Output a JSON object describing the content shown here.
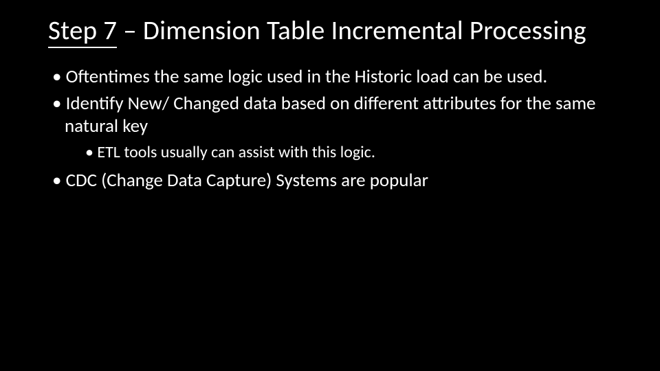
{
  "title": {
    "step_label": "Step 7",
    "rest": " – Dimension Table Incremental Processing"
  },
  "bullets": [
    {
      "text": "Oftentimes the same logic used in the Historic load can be used.",
      "children": []
    },
    {
      "text": "Identify New/ Changed data based on different attributes for the same natural key",
      "children": [
        {
          "text": "ETL tools usually can assist with this logic."
        }
      ]
    },
    {
      "text": "CDC (Change Data Capture) Systems are popular",
      "children": []
    }
  ]
}
